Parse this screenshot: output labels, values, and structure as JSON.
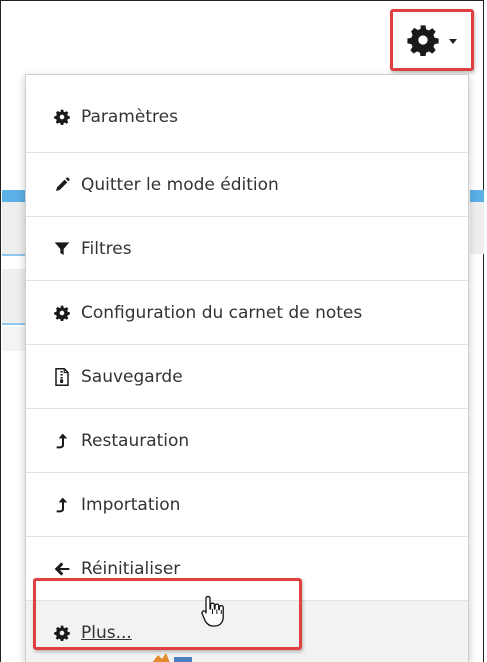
{
  "toolbar": {
    "settings_icon": "gear-icon",
    "dropdown_icon": "caret-down-icon",
    "highlight_color": "#e04040"
  },
  "menu": {
    "items": [
      {
        "label": "Paramètres",
        "icon": "gear-icon"
      },
      {
        "label": "Quitter le mode édition",
        "icon": "pencil-icon"
      },
      {
        "label": "Filtres",
        "icon": "filter-icon"
      },
      {
        "label": "Configuration du carnet de notes",
        "icon": "gear-icon"
      },
      {
        "label": "Sauvegarde",
        "icon": "backup-file-icon"
      },
      {
        "label": "Restauration",
        "icon": "upload-arrow-icon"
      },
      {
        "label": "Importation",
        "icon": "upload-arrow-icon"
      },
      {
        "label": "Réinitialiser",
        "icon": "arrow-left-icon"
      },
      {
        "label": "Plus...",
        "icon": "gear-icon"
      }
    ]
  },
  "colors": {
    "accent_blue": "#5bb0e6",
    "highlight_red": "#e04040",
    "text": "#333333"
  }
}
